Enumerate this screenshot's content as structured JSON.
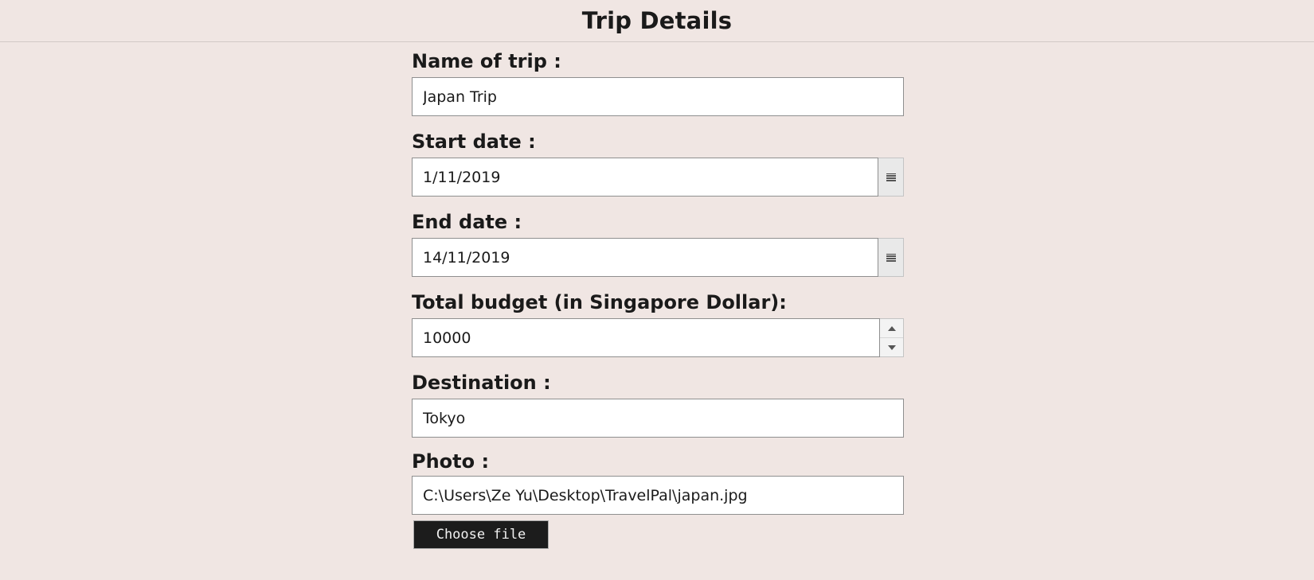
{
  "header": {
    "title": "Trip Details"
  },
  "fields": {
    "name": {
      "label": "Name of trip :",
      "value": "Japan Trip"
    },
    "start_date": {
      "label": "Start date :",
      "value": "1/11/2019",
      "icon": "calendar-icon"
    },
    "end_date": {
      "label": "End date :",
      "value": "14/11/2019",
      "icon": "calendar-icon"
    },
    "budget": {
      "label": "Total budget (in Singapore Dollar):",
      "value": "10000"
    },
    "destination": {
      "label": "Destination :",
      "value": "Tokyo"
    },
    "photo": {
      "label": "Photo :",
      "value": "C:\\Users\\Ze Yu\\Desktop\\TravelPal\\japan.jpg",
      "button_label": "Choose file"
    }
  },
  "colors": {
    "background": "#f0e6e3",
    "input_border": "#8f8f8f",
    "file_button_bg": "#1c1c1c"
  }
}
